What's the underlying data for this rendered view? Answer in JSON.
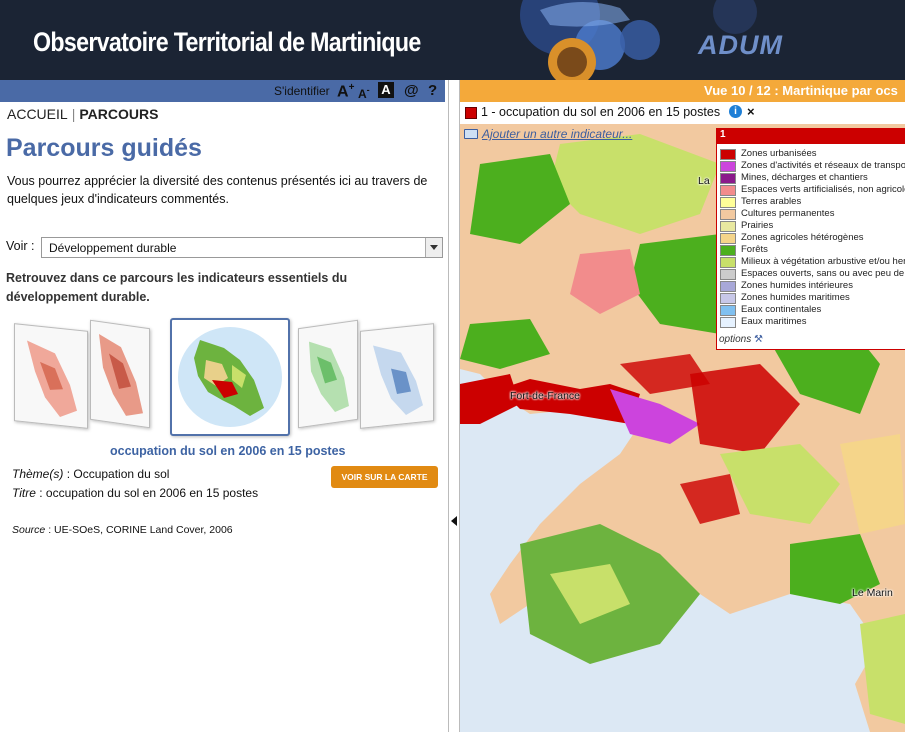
{
  "header": {
    "title": "Observatoire Territorial de Martinique",
    "logo": "ADUM"
  },
  "toolbar": {
    "login": "S'identifier",
    "font_up": "A",
    "font_down": "A",
    "contrast": "A",
    "contact": "@",
    "help": "?"
  },
  "breadcrumb": {
    "home": "ACCUEIL",
    "current": "PARCOURS"
  },
  "page": {
    "title": "Parcours guidés",
    "intro": "Vous pourrez apprécier la diversité des contenus présentés ici au travers de quelques jeux d'indicateurs commentés.",
    "voir_label": "Voir :",
    "voir_value": "Développement durable",
    "description": "Retrouvez dans ce parcours les indicateurs essentiels du développement durable.",
    "thumb_caption": "occupation du sol en 2006 en 15 postes",
    "theme_label": "Thème(s)",
    "theme_value": ": Occupation du sol",
    "titre_label": "Titre",
    "titre_value": ": occupation du sol en 2006 en 15 postes",
    "voir_carte": "VOIR SUR LA CARTE",
    "source_label": "Source",
    "source_value": ": UE-SOeS, CORINE Land Cover, 2006"
  },
  "map": {
    "view_title": "Vue 10 / 12 : Martinique par ocs",
    "indicator": "1 - occupation du sol en 2006 en 15 postes",
    "indicator_color": "#cc0000",
    "add_indicator": "Ajouter un autre indicateur...",
    "places": [
      "Fort-de-France",
      "Le Marin",
      "La"
    ],
    "legend": {
      "number": "1",
      "options": "options",
      "items": [
        {
          "label": "Zones urbanisées",
          "color": "#cc0000"
        },
        {
          "label": "Zones d'activités et réseaux de transport",
          "color": "#cc44dd"
        },
        {
          "label": "Mines, décharges et chantiers",
          "color": "#8b1a8b"
        },
        {
          "label": "Espaces verts artificialisés, non agricoles",
          "color": "#f28c8c"
        },
        {
          "label": "Terres arables",
          "color": "#ffff99"
        },
        {
          "label": "Cultures permanentes",
          "color": "#f2c9a0"
        },
        {
          "label": "Prairies",
          "color": "#e8e8a0"
        },
        {
          "label": "Zones agricoles hétérogènes",
          "color": "#f5d58a"
        },
        {
          "label": "Forêts",
          "color": "#4caf1e"
        },
        {
          "label": "Milieux à végétation arbustive et/ou herbacée",
          "color": "#c8e06a"
        },
        {
          "label": "Espaces ouverts, sans ou avec peu de végétation",
          "color": "#cccccc"
        },
        {
          "label": "Zones humides intérieures",
          "color": "#a8a8d8"
        },
        {
          "label": "Zones humides maritimes",
          "color": "#c8c8e8"
        },
        {
          "label": "Eaux continentales",
          "color": "#80c0f0"
        },
        {
          "label": "Eaux maritimes",
          "color": "#e6f2ff"
        }
      ]
    }
  }
}
